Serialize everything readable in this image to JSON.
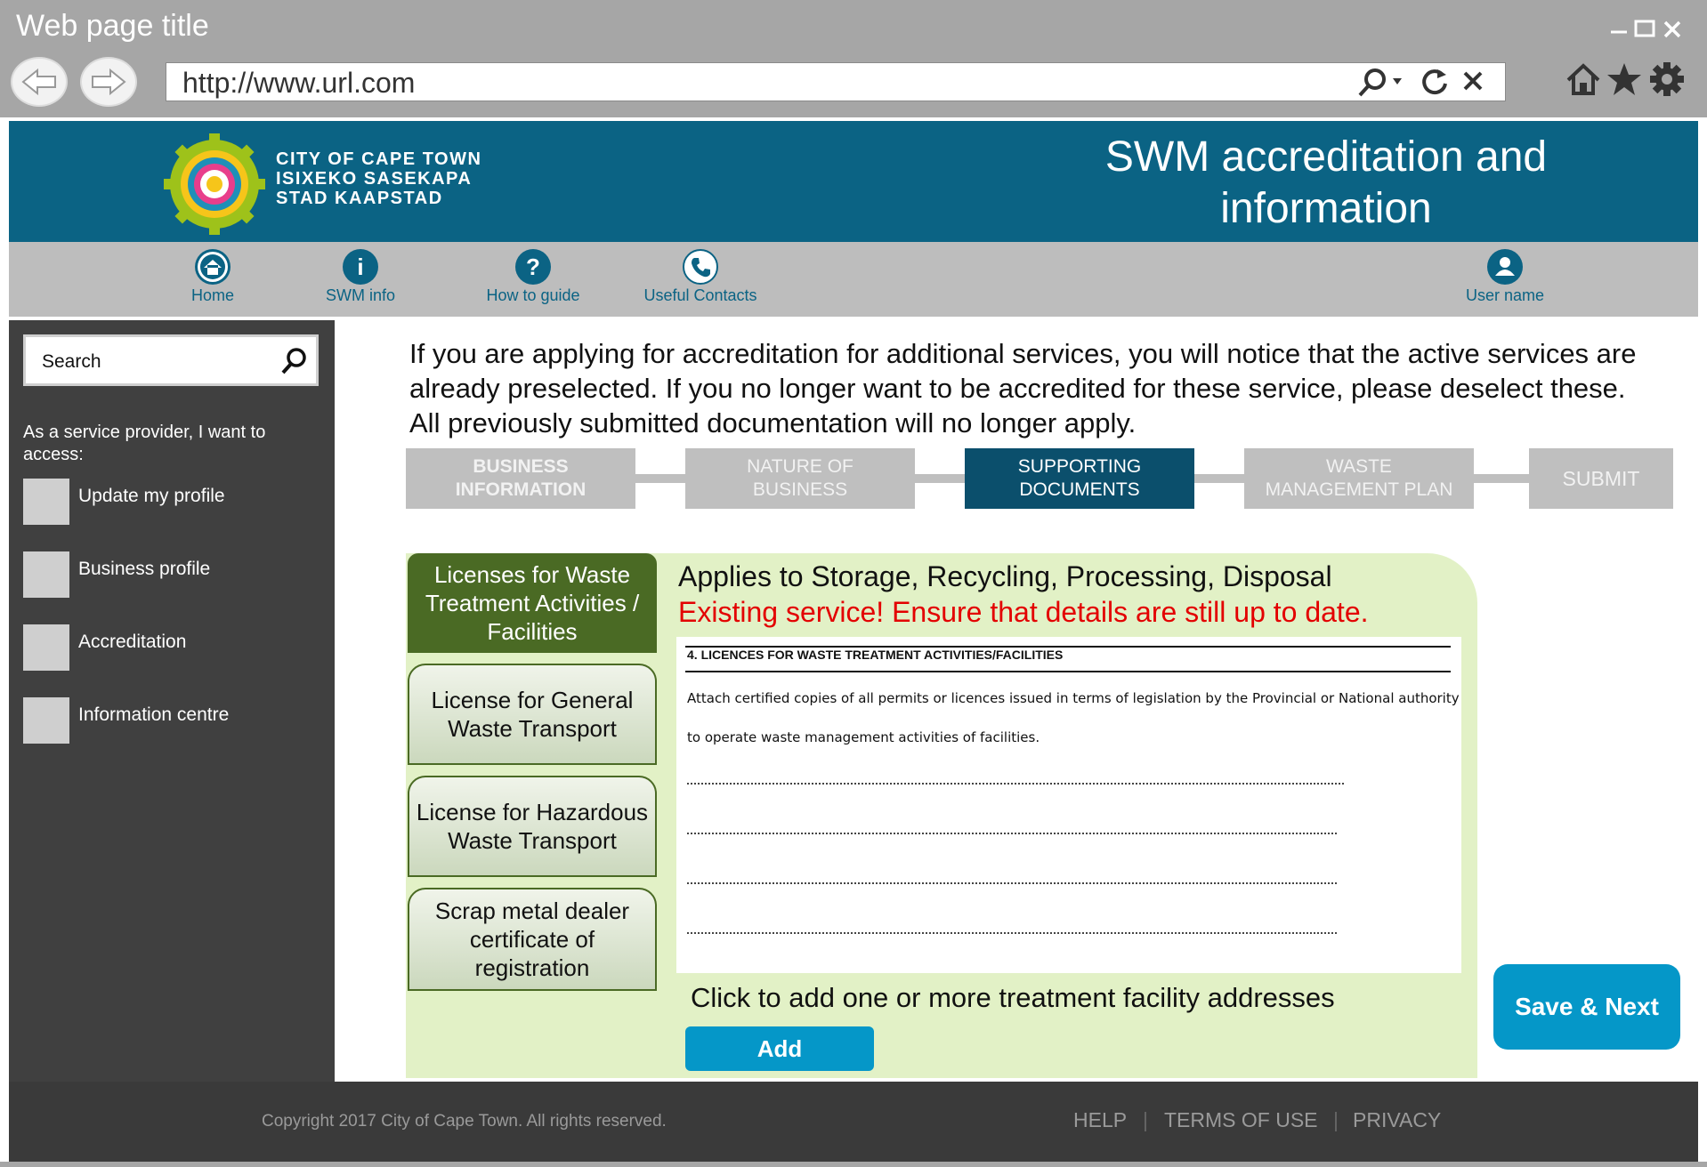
{
  "window": {
    "title": "Web page title",
    "url": "http://www.url.com"
  },
  "header": {
    "brand_lines": [
      "CITY OF CAPE TOWN",
      "ISIXEKO SASEKAPA",
      "STAD KAAPSTAD"
    ],
    "title_line1": "SWM accreditation and",
    "title_line2": "information"
  },
  "nav": {
    "items": [
      {
        "label": "Home",
        "icon": "home-icon"
      },
      {
        "label": "SWM info",
        "icon": "info-icon"
      },
      {
        "label": "How to guide",
        "icon": "help-icon"
      },
      {
        "label": "Useful Contacts",
        "icon": "phone-icon"
      }
    ],
    "user_label": "User name"
  },
  "sidebar": {
    "search_label": "Search",
    "intro": "As a service provider, I want to access:",
    "items": [
      {
        "label": "Update my profile"
      },
      {
        "label": "Business profile"
      },
      {
        "label": "Accreditation"
      },
      {
        "label": "Information centre"
      }
    ]
  },
  "main": {
    "intro": "If you are applying for accreditation for additional services, you will notice that the active services are already preselected.  If you no longer want to be accredited for these service, please deselect these.  All previously submitted documentation will no longer apply.",
    "steps": [
      {
        "line1": "BUSINESS",
        "line2": "INFORMATION"
      },
      {
        "line1": "NATURE OF",
        "line2": "BUSINESS"
      },
      {
        "line1": "SUPPORTING",
        "line2": "DOCUMENTS"
      },
      {
        "line1": "WASTE",
        "line2": "MANAGEMENT PLAN"
      },
      {
        "line1": "SUBMIT",
        "line2": ""
      }
    ],
    "active_step": 2,
    "tabs": [
      {
        "line1": "Licenses for Waste",
        "line2": "Treatment Activities /",
        "line3": "Facilities"
      },
      {
        "line1": "License for General",
        "line2": "Waste Transport",
        "line3": ""
      },
      {
        "line1": "License for Hazardous",
        "line2": "Waste Transport",
        "line3": ""
      },
      {
        "line1": "Scrap metal dealer",
        "line2": "certificate of",
        "line3": "registration"
      }
    ],
    "applies_text": "Applies to Storage, Recycling, Processing, Disposal",
    "warning_text": "Existing service!  Ensure that details are still up to date.",
    "document": {
      "heading": "4. LICENCES FOR WASTE TREATMENT ACTIVITIES/FACILITIES",
      "line1": "Attach certified copies of all permits or licences issued in terms of legislation by the Provincial or National authority",
      "line2": "to operate waste management activities of facilities."
    },
    "click_text": "Click to add one or more treatment facility addresses",
    "add_label": "Add",
    "save_label": "Save & Next"
  },
  "footer": {
    "copyright": "Copyright 2017 City of Cape Town. All rights reserved.",
    "links": [
      "HELP",
      "TERMS OF USE",
      "PRIVACY"
    ]
  },
  "colors": {
    "header_blue": "#0b6384",
    "active_step": "#0b4f6c",
    "panel_green": "#e2f1c6",
    "tab_green": "#4a6a24",
    "button_blue": "#0597c8",
    "warning_red": "#e30000"
  }
}
